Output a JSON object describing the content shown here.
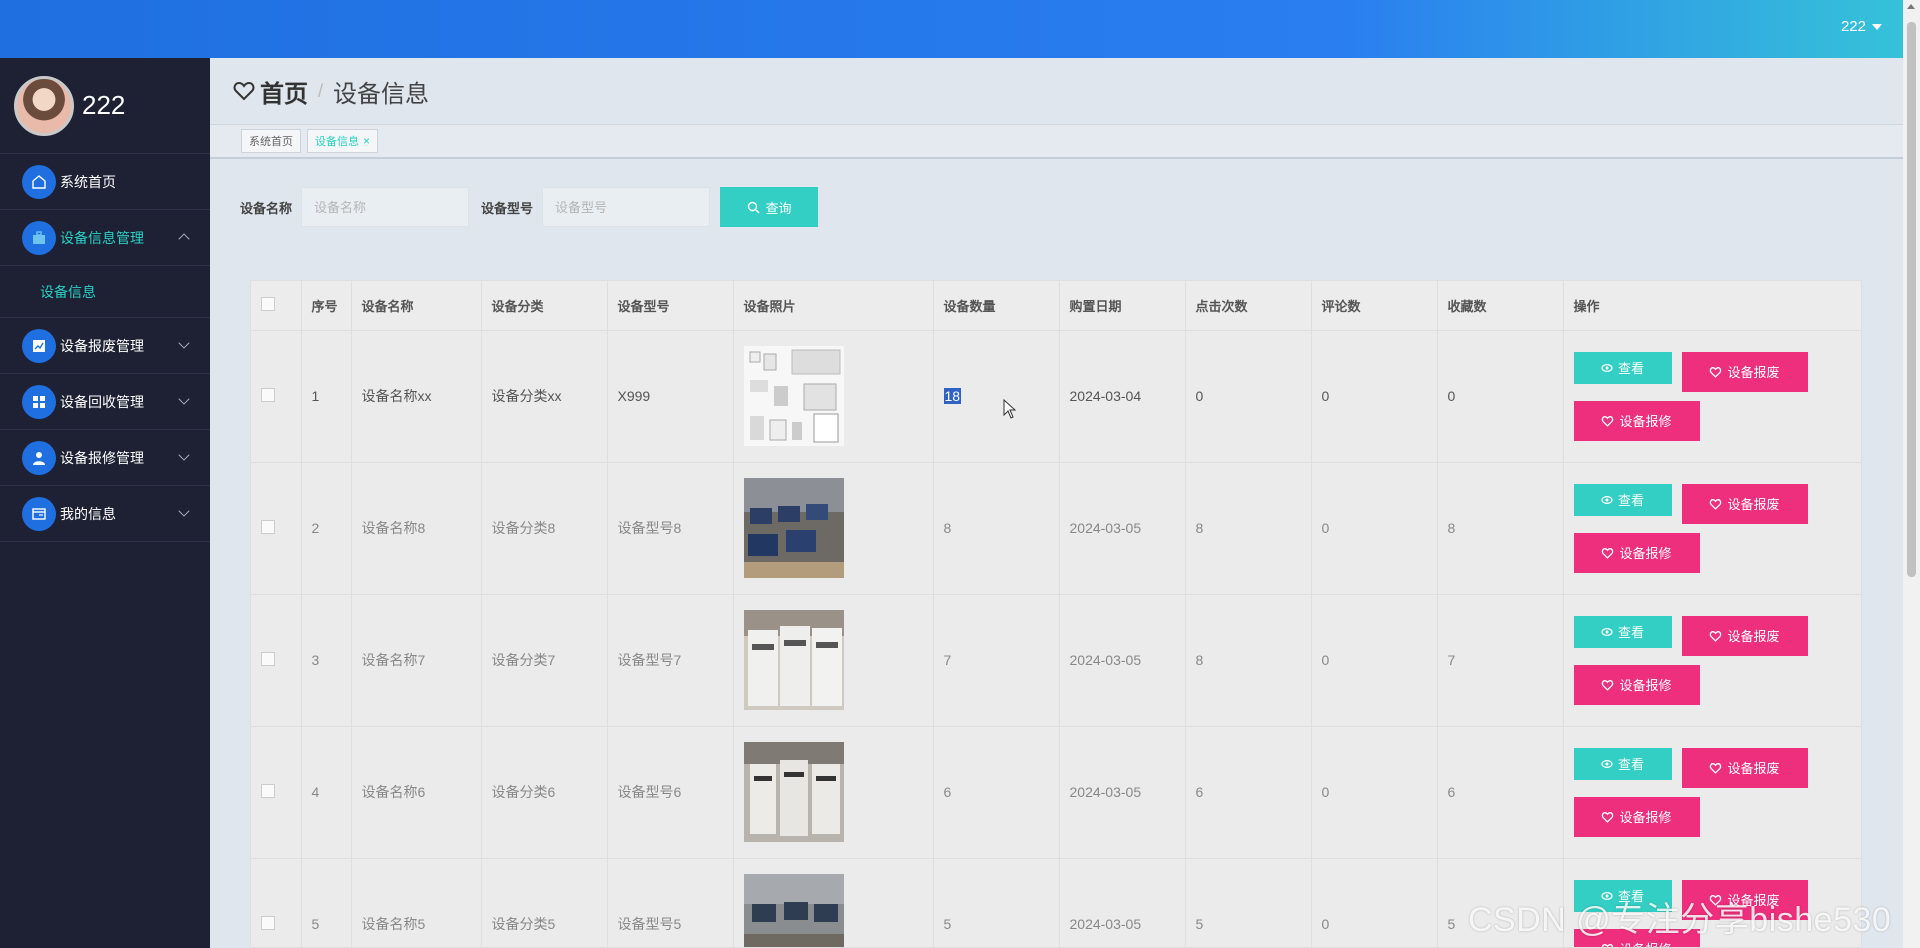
{
  "topbar": {
    "user": "222"
  },
  "sidebar": {
    "profile_name": "222",
    "items": [
      {
        "label": "系统首页",
        "icon": "home-icon"
      },
      {
        "label": "设备信息管理",
        "icon": "briefcase-icon",
        "expanded": true,
        "children": [
          {
            "label": "设备信息"
          }
        ]
      },
      {
        "label": "设备报废管理",
        "icon": "chart-icon"
      },
      {
        "label": "设备回收管理",
        "icon": "grid-icon"
      },
      {
        "label": "设备报修管理",
        "icon": "user-icon"
      },
      {
        "label": "我的信息",
        "icon": "card-icon"
      }
    ]
  },
  "header": {
    "home": "首页",
    "separator": "/",
    "current": "设备信息"
  },
  "tabs": [
    {
      "label": "系统首页"
    },
    {
      "label": "设备信息"
    }
  ],
  "search": {
    "name_label": "设备名称",
    "name_placeholder": "设备名称",
    "model_label": "设备型号",
    "model_placeholder": "设备型号",
    "query_label": "查询"
  },
  "table": {
    "columns": [
      "序号",
      "设备名称",
      "设备分类",
      "设备型号",
      "设备照片",
      "设备数量",
      "购置日期",
      "点击次数",
      "评论数",
      "收藏数",
      "操作"
    ],
    "buttons": {
      "view": "查看",
      "scrap": "设备报废",
      "repair": "设备报修"
    },
    "rows": [
      {
        "no": "1",
        "name": "设备名称xx",
        "category": "设备分类xx",
        "model": "X999",
        "photo": "smart-devices-photo",
        "qty": "18",
        "date": "2024-03-04",
        "clicks": "0",
        "comments": "0",
        "favs": "0"
      },
      {
        "no": "2",
        "name": "设备名称8",
        "category": "设备分类8",
        "model": "设备型号8",
        "photo": "computer-lab-photo",
        "qty": "8",
        "date": "2024-03-05",
        "clicks": "8",
        "comments": "0",
        "favs": "8"
      },
      {
        "no": "3",
        "name": "设备名称7",
        "category": "设备分类7",
        "model": "设备型号7",
        "photo": "copiers-photo",
        "qty": "7",
        "date": "2024-03-05",
        "clicks": "8",
        "comments": "0",
        "favs": "7"
      },
      {
        "no": "4",
        "name": "设备名称6",
        "category": "设备分类6",
        "model": "设备型号6",
        "photo": "copiers-photo-2",
        "qty": "6",
        "date": "2024-03-05",
        "clicks": "6",
        "comments": "0",
        "favs": "6"
      },
      {
        "no": "5",
        "name": "设备名称5",
        "category": "设备分类5",
        "model": "设备型号5",
        "photo": "office-photo",
        "qty": "5",
        "date": "2024-03-05",
        "clicks": "5",
        "comments": "0",
        "favs": "5"
      }
    ]
  },
  "watermark": "CSDN @专注分享bishe530",
  "colors": {
    "topbar": "#1f6fe0",
    "sidebar": "#1d2133",
    "accent": "#33cfc4",
    "pink": "#ee2f7d"
  }
}
